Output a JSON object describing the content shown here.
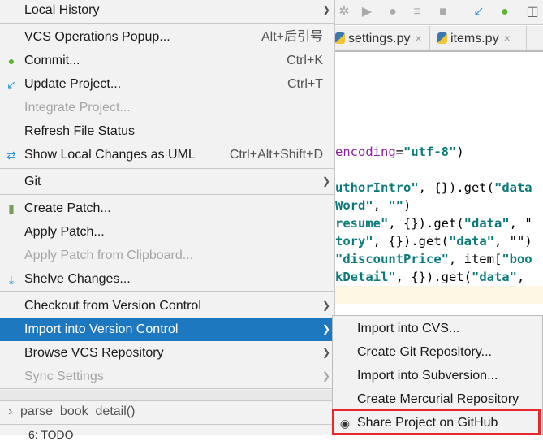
{
  "editor": {
    "tabs": [
      {
        "label": "settings.py",
        "close": "×"
      },
      {
        "label": "items.py",
        "close": "×"
      }
    ],
    "code_lines": [
      {
        "parts": [
          [
            "p",
            "encoding"
          ],
          [
            "n",
            "="
          ],
          [
            "s",
            "\"utf-8\""
          ],
          [
            "n",
            ")"
          ]
        ]
      },
      {
        "parts": [
          [
            "s",
            "uthorIntro\""
          ],
          [
            "n",
            ", {}).get("
          ],
          [
            "s",
            "\"data"
          ]
        ]
      },
      {
        "parts": [
          [
            "s",
            "Word\""
          ],
          [
            "n",
            ", "
          ],
          [
            "s",
            "\"\""
          ],
          [
            "n",
            ")"
          ]
        ]
      },
      {
        "parts": [
          [
            "s",
            "resume\""
          ],
          [
            "n",
            ", {}).get("
          ],
          [
            "s",
            "\"data\""
          ],
          [
            "n",
            ", \""
          ]
        ]
      },
      {
        "parts": [
          [
            "s",
            "tory\""
          ],
          [
            "n",
            ", {}).get("
          ],
          [
            "s",
            "\"data\""
          ],
          [
            "n",
            ", \"\")"
          ]
        ]
      },
      {
        "parts": [
          [
            "s",
            "\"discountPrice\""
          ],
          [
            "n",
            ", item["
          ],
          [
            "s",
            "\"boo"
          ]
        ]
      },
      {
        "parts": [
          [
            "s",
            "kDetail\""
          ],
          [
            "n",
            ", {}).get("
          ],
          [
            "s",
            "\"data\""
          ],
          [
            "n",
            ","
          ]
        ]
      }
    ]
  },
  "menu": {
    "items": [
      {
        "label": "Local History",
        "submenu": true
      },
      {
        "label": "VCS Operations Popup...",
        "shortcut": "Alt+后引号"
      },
      {
        "label": "Commit...",
        "shortcut": "Ctrl+K",
        "icon": "commit-icon"
      },
      {
        "label": "Update Project...",
        "shortcut": "Ctrl+T",
        "icon": "update-icon"
      },
      {
        "label": "Integrate Project...",
        "disabled": true
      },
      {
        "label": "Refresh File Status"
      },
      {
        "label": "Show Local Changes as UML",
        "shortcut": "Ctrl+Alt+Shift+D",
        "icon": "uml-icon"
      },
      {
        "label": "Git",
        "submenu": true
      },
      {
        "label": "Create Patch...",
        "icon": "patch-icon"
      },
      {
        "label": "Apply Patch..."
      },
      {
        "label": "Apply Patch from Clipboard...",
        "disabled": true
      },
      {
        "label": "Shelve Changes...",
        "icon": "shelve-icon"
      },
      {
        "label": "Checkout from Version Control",
        "submenu": true
      },
      {
        "label": "Import into Version Control",
        "submenu": true,
        "selected": true
      },
      {
        "label": "Browse VCS Repository",
        "submenu": true
      },
      {
        "label": "Sync Settings",
        "submenu": true,
        "disabled": true
      }
    ]
  },
  "submenu": {
    "items": [
      "Import into CVS...",
      "Create Git Repository...",
      "Import into Subversion...",
      "Create Mercurial Repository",
      "Share Project on GitHub"
    ]
  },
  "bottom": {
    "breadcrumb": "parse_book_detail()",
    "tool": "6: TODO"
  },
  "colors": {
    "selection": "#1e78c0",
    "highlight_box": "#e8282c"
  }
}
